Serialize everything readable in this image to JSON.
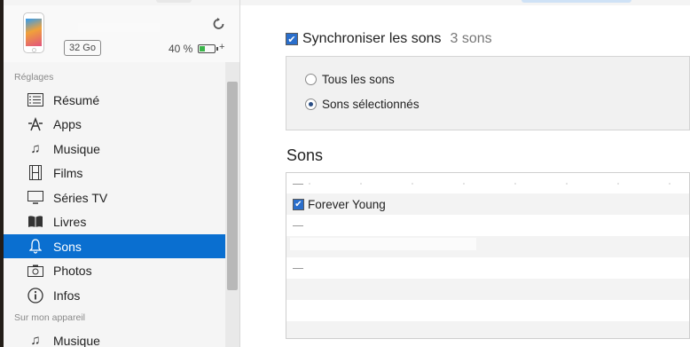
{
  "device": {
    "capacity": "32 Go",
    "battery_percent_label": "40 %",
    "battery_level": 0.4
  },
  "sidebar": {
    "section_settings": "Réglages",
    "items": [
      {
        "label": "Résumé",
        "icon": "summary-icon"
      },
      {
        "label": "Apps",
        "icon": "apps-icon"
      },
      {
        "label": "Musique",
        "icon": "music-note-icon"
      },
      {
        "label": "Films",
        "icon": "film-icon"
      },
      {
        "label": "Séries TV",
        "icon": "tv-icon"
      },
      {
        "label": "Livres",
        "icon": "book-icon"
      },
      {
        "label": "Sons",
        "icon": "bell-icon",
        "selected": true
      },
      {
        "label": "Photos",
        "icon": "camera-icon"
      },
      {
        "label": "Infos",
        "icon": "info-icon"
      }
    ],
    "section_device": "Sur mon appareil",
    "device_items": [
      {
        "label": "Musique",
        "icon": "music-note-icon"
      }
    ]
  },
  "main": {
    "sync_label": "Synchroniser les sons",
    "sync_count": "3 sons",
    "options": {
      "all": "Tous les sons",
      "selected": "Sons sélectionnés",
      "current": "selected"
    },
    "sons_title": "Sons",
    "tones": [
      {
        "label": "",
        "checked": false
      },
      {
        "label": "Forever Young",
        "checked": true
      },
      {
        "label": "",
        "checked": false
      },
      {
        "label": "",
        "checked": false
      },
      {
        "label": "",
        "checked": false
      }
    ]
  },
  "colors": {
    "selection": "#0a6fd0",
    "checkbox": "#2a6ecb",
    "battery": "#3bb54a"
  }
}
